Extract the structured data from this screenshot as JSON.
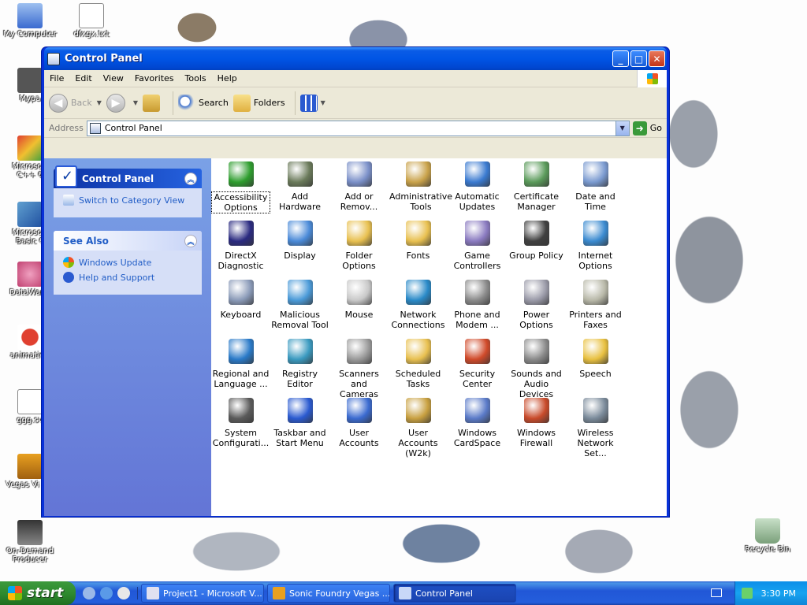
{
  "desktop": {
    "icons": [
      {
        "label": "My Computer"
      },
      {
        "label": "dfxgx.txt"
      },
      {
        "label": "Mypa"
      },
      {
        "label": "Microsoft C++ 6"
      },
      {
        "label": "Microsoft Basic 6"
      },
      {
        "label": "DataWago"
      },
      {
        "label": "animation"
      },
      {
        "label": "ggg.sv"
      },
      {
        "label": "Vegas Vi 3.0"
      },
      {
        "label": "On-Demand Producer"
      },
      {
        "label": "Recycle Bin"
      }
    ]
  },
  "window": {
    "title": "Control Panel",
    "menu": [
      "File",
      "Edit",
      "View",
      "Favorites",
      "Tools",
      "Help"
    ],
    "toolbar": {
      "back": "Back",
      "search": "Search",
      "folders": "Folders"
    },
    "address": {
      "label": "Address",
      "value": "Control Panel",
      "go": "Go"
    },
    "left": {
      "panel1": {
        "title": "Control Panel",
        "link": "Switch to Category View"
      },
      "panel2": {
        "title": "See Also",
        "links": [
          "Windows Update",
          "Help and Support"
        ]
      }
    },
    "items": [
      {
        "label": "Accessibility Options",
        "icon": "accessibility-icon",
        "color": "#2e9d2e"
      },
      {
        "label": "Add Hardware",
        "icon": "add-hardware-icon",
        "color": "#6a7a5a"
      },
      {
        "label": "Add or Remov...",
        "icon": "add-remove-programs-icon",
        "color": "#7a8fc8"
      },
      {
        "label": "Administrative Tools",
        "icon": "administrative-tools-icon",
        "color": "#c9a24a"
      },
      {
        "label": "Automatic Updates",
        "icon": "automatic-updates-icon",
        "color": "#3a7ad0"
      },
      {
        "label": "Certificate Manager",
        "icon": "certificate-icon",
        "color": "#5a9a5a"
      },
      {
        "label": "Date and Time",
        "icon": "clock-icon",
        "color": "#7a9ad0"
      },
      {
        "label": "DirectX Diagnostic",
        "icon": "directx-icon",
        "color": "#2a2a80"
      },
      {
        "label": "Display",
        "icon": "display-icon",
        "color": "#4a8ad8"
      },
      {
        "label": "Folder Options",
        "icon": "folder-options-icon",
        "color": "#e8c050"
      },
      {
        "label": "Fonts",
        "icon": "fonts-folder-icon",
        "color": "#e8c050"
      },
      {
        "label": "Game Controllers",
        "icon": "gamepad-icon",
        "color": "#8a7ac0"
      },
      {
        "label": "Group Policy",
        "icon": "group-policy-icon",
        "color": "#404040"
      },
      {
        "label": "Internet Options",
        "icon": "internet-options-icon",
        "color": "#3a8ad0"
      },
      {
        "label": "Keyboard",
        "icon": "keyboard-icon",
        "color": "#8a9ab8"
      },
      {
        "label": "Malicious Removal Tool",
        "icon": "malicious-removal-icon",
        "color": "#4a9ad8"
      },
      {
        "label": "Mouse",
        "icon": "mouse-icon",
        "color": "#c8c8c8"
      },
      {
        "label": "Network Connections",
        "icon": "network-icon",
        "color": "#2a8ac8"
      },
      {
        "label": "Phone and Modem ...",
        "icon": "phone-modem-icon",
        "color": "#8a8a8a"
      },
      {
        "label": "Power Options",
        "icon": "power-options-icon",
        "color": "#9a9aa8"
      },
      {
        "label": "Printers and Faxes",
        "icon": "printer-icon",
        "color": "#b8b8a8"
      },
      {
        "label": "Regional and Language ...",
        "icon": "globe-icon",
        "color": "#2a7ac8"
      },
      {
        "label": "Registry Editor",
        "icon": "registry-editor-icon",
        "color": "#3a9ac0"
      },
      {
        "label": "Scanners and Cameras",
        "icon": "scanner-camera-icon",
        "color": "#9a9a9a"
      },
      {
        "label": "Scheduled Tasks",
        "icon": "scheduled-tasks-icon",
        "color": "#e8c050"
      },
      {
        "label": "Security Center",
        "icon": "security-shield-icon",
        "color": "#d04a2a"
      },
      {
        "label": "Sounds and Audio Devices",
        "icon": "speaker-icon",
        "color": "#8a8a8a"
      },
      {
        "label": "Speech",
        "icon": "speech-icon",
        "color": "#e8c040"
      },
      {
        "label": "System Configurati...",
        "icon": "system-config-icon",
        "color": "#5a5a5a"
      },
      {
        "label": "Taskbar and Start Menu",
        "icon": "taskbar-icon",
        "color": "#2a5ad0"
      },
      {
        "label": "User Accounts",
        "icon": "user-accounts-icon",
        "color": "#3a6ad0"
      },
      {
        "label": "User Accounts (W2k)",
        "icon": "user-accounts-w2k-icon",
        "color": "#c8a040"
      },
      {
        "label": "Windows CardSpace",
        "icon": "cardspace-icon",
        "color": "#5a7ac8"
      },
      {
        "label": "Windows Firewall",
        "icon": "firewall-icon",
        "color": "#c84a2a"
      },
      {
        "label": "Wireless Network Set...",
        "icon": "wireless-icon",
        "color": "#7a8a9a"
      }
    ]
  },
  "taskbar": {
    "start": "start",
    "tasks": [
      "Project1 - Microsoft V...",
      "Sonic Foundry Vegas ...",
      "Control Panel"
    ],
    "clock": "3:30 PM"
  }
}
